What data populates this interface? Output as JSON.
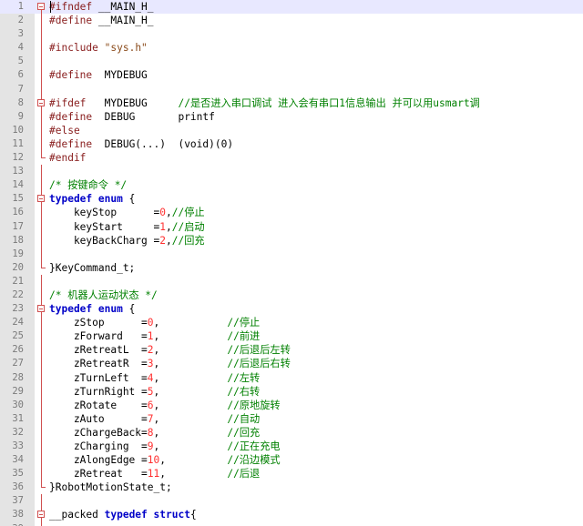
{
  "editor": {
    "lines": [
      {
        "n": "1",
        "fold": "start",
        "current": true,
        "tokens": [
          {
            "t": "#ifndef",
            "c": "pp"
          },
          {
            "t": " __MAIN_H_",
            "c": "id"
          }
        ]
      },
      {
        "n": "2",
        "fold": "mid",
        "tokens": [
          {
            "t": "#define",
            "c": "pp"
          },
          {
            "t": " __MAIN_H_",
            "c": "id"
          }
        ]
      },
      {
        "n": "3",
        "fold": "mid",
        "tokens": []
      },
      {
        "n": "4",
        "fold": "mid",
        "tokens": [
          {
            "t": "#include",
            "c": "pp"
          },
          {
            "t": " ",
            "c": "id"
          },
          {
            "t": "\"sys.h\"",
            "c": "str"
          }
        ]
      },
      {
        "n": "5",
        "fold": "mid",
        "tokens": []
      },
      {
        "n": "6",
        "fold": "mid",
        "tokens": [
          {
            "t": "#define",
            "c": "pp"
          },
          {
            "t": "  MYDEBUG",
            "c": "id"
          }
        ]
      },
      {
        "n": "7",
        "fold": "mid",
        "tokens": []
      },
      {
        "n": "8",
        "fold": "start",
        "tokens": [
          {
            "t": "#ifdef",
            "c": "pp"
          },
          {
            "t": "   MYDEBUG     ",
            "c": "id"
          },
          {
            "t": "//是否进入串口调试 进入会有串口1信息输出 并可以用usmart调",
            "c": "cm"
          }
        ]
      },
      {
        "n": "9",
        "fold": "mid",
        "tokens": [
          {
            "t": "#define",
            "c": "pp"
          },
          {
            "t": "  DEBUG       printf",
            "c": "id"
          }
        ]
      },
      {
        "n": "10",
        "fold": "mid",
        "tokens": [
          {
            "t": "#else",
            "c": "pp"
          }
        ]
      },
      {
        "n": "11",
        "fold": "mid",
        "tokens": [
          {
            "t": "#define",
            "c": "pp"
          },
          {
            "t": "  DEBUG(...)  (void)(0)",
            "c": "id"
          }
        ]
      },
      {
        "n": "12",
        "fold": "end",
        "tokens": [
          {
            "t": "#endif",
            "c": "pp"
          }
        ]
      },
      {
        "n": "13",
        "fold": "mid",
        "tokens": []
      },
      {
        "n": "14",
        "fold": "mid",
        "tokens": [
          {
            "t": "/* 按键命令 */",
            "c": "cm"
          }
        ]
      },
      {
        "n": "15",
        "fold": "start",
        "tokens": [
          {
            "t": "typedef",
            "c": "kw"
          },
          {
            "t": " ",
            "c": "id"
          },
          {
            "t": "enum",
            "c": "kw"
          },
          {
            "t": " {",
            "c": "id"
          }
        ]
      },
      {
        "n": "16",
        "fold": "mid",
        "tokens": [
          {
            "t": "    keyStop      =",
            "c": "id"
          },
          {
            "t": "0",
            "c": "num"
          },
          {
            "t": ",",
            "c": "id"
          },
          {
            "t": "//停止",
            "c": "cm"
          }
        ]
      },
      {
        "n": "17",
        "fold": "mid",
        "tokens": [
          {
            "t": "    keyStart     =",
            "c": "id"
          },
          {
            "t": "1",
            "c": "num"
          },
          {
            "t": ",",
            "c": "id"
          },
          {
            "t": "//启动",
            "c": "cm"
          }
        ]
      },
      {
        "n": "18",
        "fold": "mid",
        "tokens": [
          {
            "t": "    keyBackCharg =",
            "c": "id"
          },
          {
            "t": "2",
            "c": "num"
          },
          {
            "t": ",",
            "c": "id"
          },
          {
            "t": "//回充",
            "c": "cm"
          }
        ]
      },
      {
        "n": "19",
        "fold": "mid",
        "tokens": []
      },
      {
        "n": "20",
        "fold": "end",
        "tokens": [
          {
            "t": "}KeyCommand_t;",
            "c": "id"
          }
        ]
      },
      {
        "n": "21",
        "fold": "mid",
        "tokens": []
      },
      {
        "n": "22",
        "fold": "mid",
        "tokens": [
          {
            "t": "/* 机器人运动状态 */",
            "c": "cm"
          }
        ]
      },
      {
        "n": "23",
        "fold": "start",
        "tokens": [
          {
            "t": "typedef",
            "c": "kw"
          },
          {
            "t": " ",
            "c": "id"
          },
          {
            "t": "enum",
            "c": "kw"
          },
          {
            "t": " {",
            "c": "id"
          }
        ]
      },
      {
        "n": "24",
        "fold": "mid",
        "tokens": [
          {
            "t": "    zStop      =",
            "c": "id"
          },
          {
            "t": "0",
            "c": "num"
          },
          {
            "t": ",           ",
            "c": "id"
          },
          {
            "t": "//停止",
            "c": "cm"
          }
        ]
      },
      {
        "n": "25",
        "fold": "mid",
        "tokens": [
          {
            "t": "    zForward   =",
            "c": "id"
          },
          {
            "t": "1",
            "c": "num"
          },
          {
            "t": ",           ",
            "c": "id"
          },
          {
            "t": "//前进",
            "c": "cm"
          }
        ]
      },
      {
        "n": "26",
        "fold": "mid",
        "tokens": [
          {
            "t": "    zRetreatL  =",
            "c": "id"
          },
          {
            "t": "2",
            "c": "num"
          },
          {
            "t": ",           ",
            "c": "id"
          },
          {
            "t": "//后退后左转",
            "c": "cm"
          }
        ]
      },
      {
        "n": "27",
        "fold": "mid",
        "tokens": [
          {
            "t": "    zRetreatR  =",
            "c": "id"
          },
          {
            "t": "3",
            "c": "num"
          },
          {
            "t": ",           ",
            "c": "id"
          },
          {
            "t": "//后退后右转",
            "c": "cm"
          }
        ]
      },
      {
        "n": "28",
        "fold": "mid",
        "tokens": [
          {
            "t": "    zTurnLeft  =",
            "c": "id"
          },
          {
            "t": "4",
            "c": "num"
          },
          {
            "t": ",           ",
            "c": "id"
          },
          {
            "t": "//左转",
            "c": "cm"
          }
        ]
      },
      {
        "n": "29",
        "fold": "mid",
        "tokens": [
          {
            "t": "    zTurnRight =",
            "c": "id"
          },
          {
            "t": "5",
            "c": "num"
          },
          {
            "t": ",           ",
            "c": "id"
          },
          {
            "t": "//右转",
            "c": "cm"
          }
        ]
      },
      {
        "n": "30",
        "fold": "mid",
        "tokens": [
          {
            "t": "    zRotate    =",
            "c": "id"
          },
          {
            "t": "6",
            "c": "num"
          },
          {
            "t": ",           ",
            "c": "id"
          },
          {
            "t": "//原地旋转",
            "c": "cm"
          }
        ]
      },
      {
        "n": "31",
        "fold": "mid",
        "tokens": [
          {
            "t": "    zAuto      =",
            "c": "id"
          },
          {
            "t": "7",
            "c": "num"
          },
          {
            "t": ",           ",
            "c": "id"
          },
          {
            "t": "//自动",
            "c": "cm"
          }
        ]
      },
      {
        "n": "32",
        "fold": "mid",
        "tokens": [
          {
            "t": "    zChargeBack=",
            "c": "id"
          },
          {
            "t": "8",
            "c": "num"
          },
          {
            "t": ",           ",
            "c": "id"
          },
          {
            "t": "//回充",
            "c": "cm"
          }
        ]
      },
      {
        "n": "33",
        "fold": "mid",
        "tokens": [
          {
            "t": "    zCharging  =",
            "c": "id"
          },
          {
            "t": "9",
            "c": "num"
          },
          {
            "t": ",           ",
            "c": "id"
          },
          {
            "t": "//正在充电",
            "c": "cm"
          }
        ]
      },
      {
        "n": "34",
        "fold": "mid",
        "tokens": [
          {
            "t": "    zAlongEdge =",
            "c": "id"
          },
          {
            "t": "10",
            "c": "num"
          },
          {
            "t": ",          ",
            "c": "id"
          },
          {
            "t": "//沿边模式",
            "c": "cm"
          }
        ]
      },
      {
        "n": "35",
        "fold": "mid",
        "tokens": [
          {
            "t": "    zRetreat   =",
            "c": "id"
          },
          {
            "t": "11",
            "c": "num"
          },
          {
            "t": ",          ",
            "c": "id"
          },
          {
            "t": "//后退",
            "c": "cm"
          }
        ]
      },
      {
        "n": "36",
        "fold": "end",
        "tokens": [
          {
            "t": "}RobotMotionState_t;",
            "c": "id"
          }
        ]
      },
      {
        "n": "37",
        "fold": "mid",
        "tokens": []
      },
      {
        "n": "38",
        "fold": "start",
        "tokens": [
          {
            "t": "__packed ",
            "c": "id"
          },
          {
            "t": "typedef",
            "c": "kw"
          },
          {
            "t": " ",
            "c": "id"
          },
          {
            "t": "struct",
            "c": "kw"
          },
          {
            "t": "{",
            "c": "id"
          }
        ]
      },
      {
        "n": "39",
        "fold": "mid",
        "tokens": []
      }
    ]
  }
}
